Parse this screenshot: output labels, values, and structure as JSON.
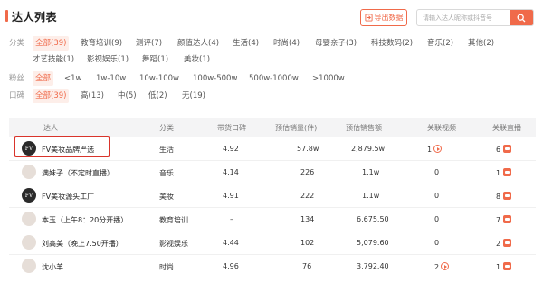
{
  "header": {
    "title": "达人列表",
    "export_label": "导出数据",
    "search": {
      "placeholder": "请输入达人昵称或抖音号"
    }
  },
  "filters": {
    "category": {
      "label": "分类",
      "options": [
        "全部(39)",
        "教育培训(9)",
        "测评(7)",
        "颜值达人(4)",
        "生活(4)",
        "时尚(4)",
        "母婴亲子(3)",
        "科技数码(2)",
        "音乐(2)",
        "其他(2)",
        "才艺技能(1)",
        "影视娱乐(1)",
        "舞蹈(1)",
        "美妆(1)"
      ],
      "active": 0
    },
    "fans": {
      "label": "粉丝",
      "options": [
        "全部",
        "<1w",
        "1w-10w",
        "10w-100w",
        "100w-500w",
        "500w-1000w",
        ">1000w"
      ],
      "active": 0
    },
    "reputation": {
      "label": "口碑",
      "options": [
        "全部(39)",
        "高(13)",
        "中(5)",
        "低(2)",
        "无(19)"
      ],
      "active": 0
    }
  },
  "table": {
    "columns": [
      "达人",
      "分类",
      "带货口碑",
      "预估销量(件)",
      "预估销售额",
      "关联视频",
      "关联直播"
    ],
    "rows": [
      {
        "name": "FV美妆品牌严选",
        "avatar": "FV",
        "category": "生活",
        "score": "4.92",
        "sales": "57.8w",
        "revenue": "2,879.5w",
        "videos": "1",
        "videos_icon": true,
        "lives": "6"
      },
      {
        "name": "满妹子（不定时直播）",
        "avatar": "",
        "category": "音乐",
        "score": "4.14",
        "sales": "226",
        "revenue": "1.1w",
        "videos": "0",
        "videos_icon": false,
        "lives": "1"
      },
      {
        "name": "FV美妆源头工厂",
        "avatar": "FV",
        "category": "美妆",
        "score": "4.91",
        "sales": "222",
        "revenue": "1.1w",
        "videos": "0",
        "videos_icon": false,
        "lives": "8"
      },
      {
        "name": "本玉（上午8：20分开播）",
        "avatar": "",
        "category": "教育培训",
        "score": "–",
        "sales": "134",
        "revenue": "6,675.50",
        "videos": "0",
        "videos_icon": false,
        "lives": "7"
      },
      {
        "name": "刘高美（晚上7.50开播）",
        "avatar": "",
        "category": "影视娱乐",
        "score": "4.44",
        "sales": "102",
        "revenue": "5,079.60",
        "videos": "0",
        "videos_icon": false,
        "lives": "2"
      },
      {
        "name": "沈小羊",
        "avatar": "",
        "category": "时尚",
        "score": "4.96",
        "sales": "76",
        "revenue": "3,792.40",
        "videos": "2",
        "videos_icon": true,
        "lives": "1"
      }
    ]
  },
  "colors": {
    "accent": "#f06a4a",
    "highlight_border": "#d9342b"
  }
}
